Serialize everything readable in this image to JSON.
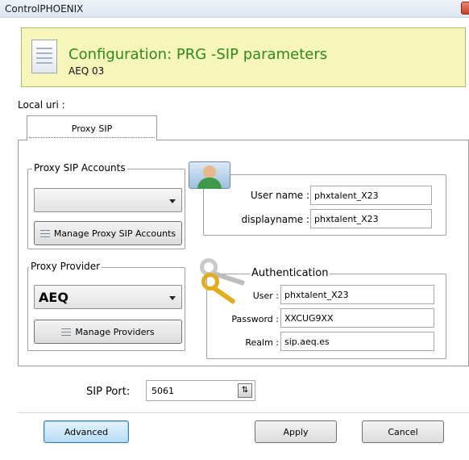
{
  "window": {
    "title": "ControlPHOENIX"
  },
  "header": {
    "title": "Configuration: PRG -SIP parameters",
    "subtitle": "AEQ 03"
  },
  "local_uri_label": "Local uri :",
  "tabs": [
    {
      "label": "Proxy SIP",
      "selected": true
    }
  ],
  "proxy_accounts": {
    "legend": "Proxy SIP Accounts",
    "selected_value": "",
    "manage_button": "Manage Proxy SIP Accounts"
  },
  "proxy_provider": {
    "legend": "Proxy Provider",
    "selected_value": "AEQ",
    "manage_button": "Manage Providers"
  },
  "user": {
    "username_label": "User name :",
    "username_value": "phxtalent_X23",
    "displayname_label": "displayname :",
    "displayname_value": "phxtalent_X23"
  },
  "authentication": {
    "legend": "Authentication",
    "user_label": "User :",
    "user_value": "phxtalent_X23",
    "password_label": "Password :",
    "password_value": "XXCUG9XX",
    "realm_label": "Realm :",
    "realm_value": "sip.aeq.es"
  },
  "sip_port": {
    "label": "SIP Port:",
    "value": "5061"
  },
  "buttons": {
    "advanced": "Advanced",
    "apply": "Apply",
    "cancel": "Cancel"
  },
  "colors": {
    "header_bg": "#f6f5ba",
    "header_title": "#2f8a1c",
    "primary_button": "#b7dcf5"
  },
  "icons": {
    "header": "document-icon",
    "user": "user-avatar-icon",
    "auth": "keys-icon",
    "manage": "list-icon",
    "spin": "spin-arrows-icon"
  }
}
